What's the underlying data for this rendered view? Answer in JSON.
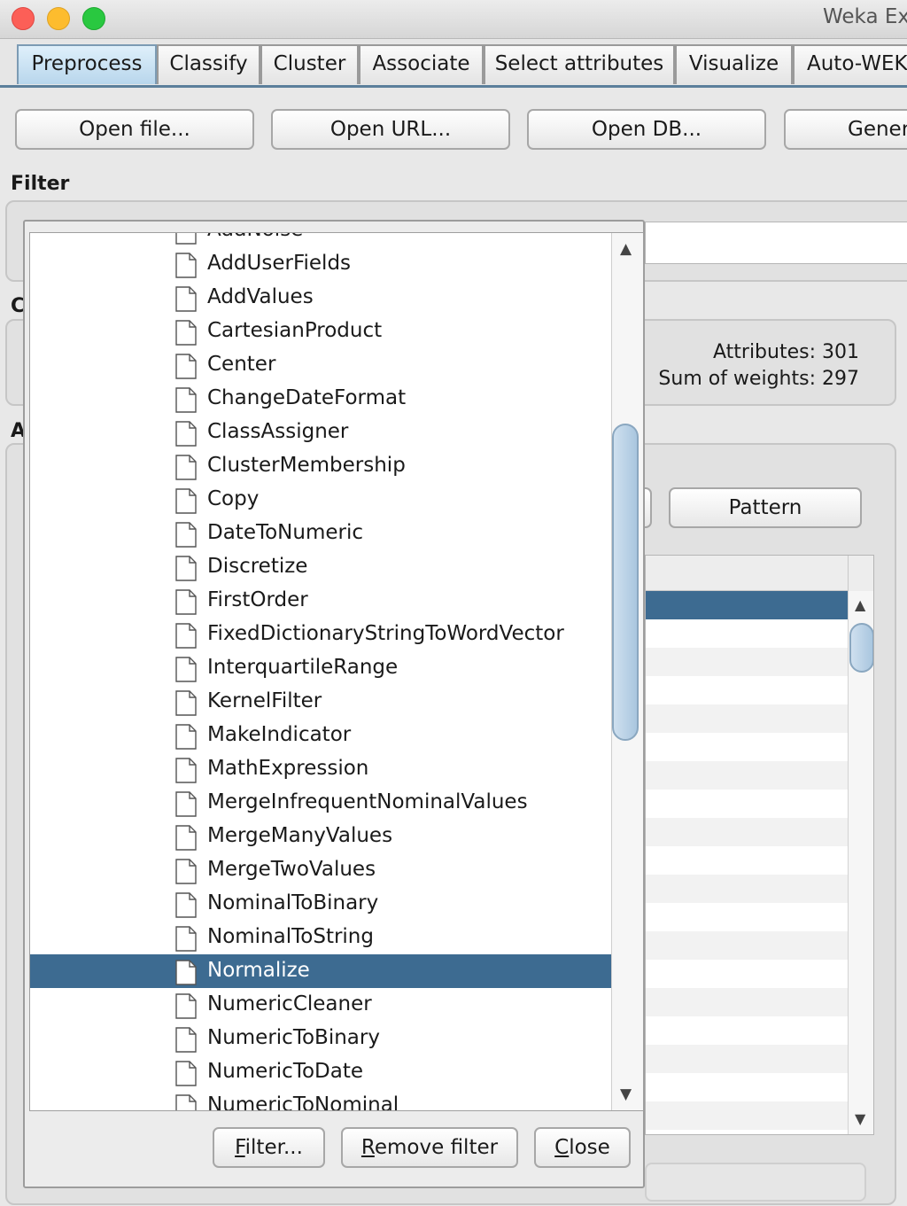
{
  "window": {
    "title": "Weka Explorer"
  },
  "tabs": [
    "Preprocess",
    "Classify",
    "Cluster",
    "Associate",
    "Select attributes",
    "Visualize",
    "Auto-WEKA"
  ],
  "toolbar": {
    "open_file": "Open file...",
    "open_url": "Open URL...",
    "open_db": "Open DB...",
    "generate": "Generate..."
  },
  "filter_section": {
    "label": "Filter"
  },
  "current_relation": {
    "attributes_label": "Attributes:",
    "attributes_value": "301",
    "weights_label": "Sum of weights:",
    "weights_value": "297"
  },
  "attributes_section": {
    "pattern_button": "Pattern"
  },
  "popup": {
    "items": [
      "AddNoise",
      "AddUserFields",
      "AddValues",
      "CartesianProduct",
      "Center",
      "ChangeDateFormat",
      "ClassAssigner",
      "ClusterMembership",
      "Copy",
      "DateToNumeric",
      "Discretize",
      "FirstOrder",
      "FixedDictionaryStringToWordVector",
      "InterquartileRange",
      "KernelFilter",
      "MakeIndicator",
      "MathExpression",
      "MergeInfrequentNominalValues",
      "MergeManyValues",
      "MergeTwoValues",
      "NominalToBinary",
      "NominalToString",
      "Normalize",
      "NumericCleaner",
      "NumericToBinary",
      "NumericToDate",
      "NumericToNominal"
    ],
    "selected": "Normalize",
    "filter_button": {
      "mnemonic": "F",
      "rest": "ilter..."
    },
    "remove_button": {
      "mnemonic": "R",
      "rest": "emove filter"
    },
    "close_button": {
      "mnemonic": "C",
      "rest": "lose"
    }
  },
  "colors": {
    "selection": "#3d6b91",
    "active_tab": "#b8d6ec"
  }
}
